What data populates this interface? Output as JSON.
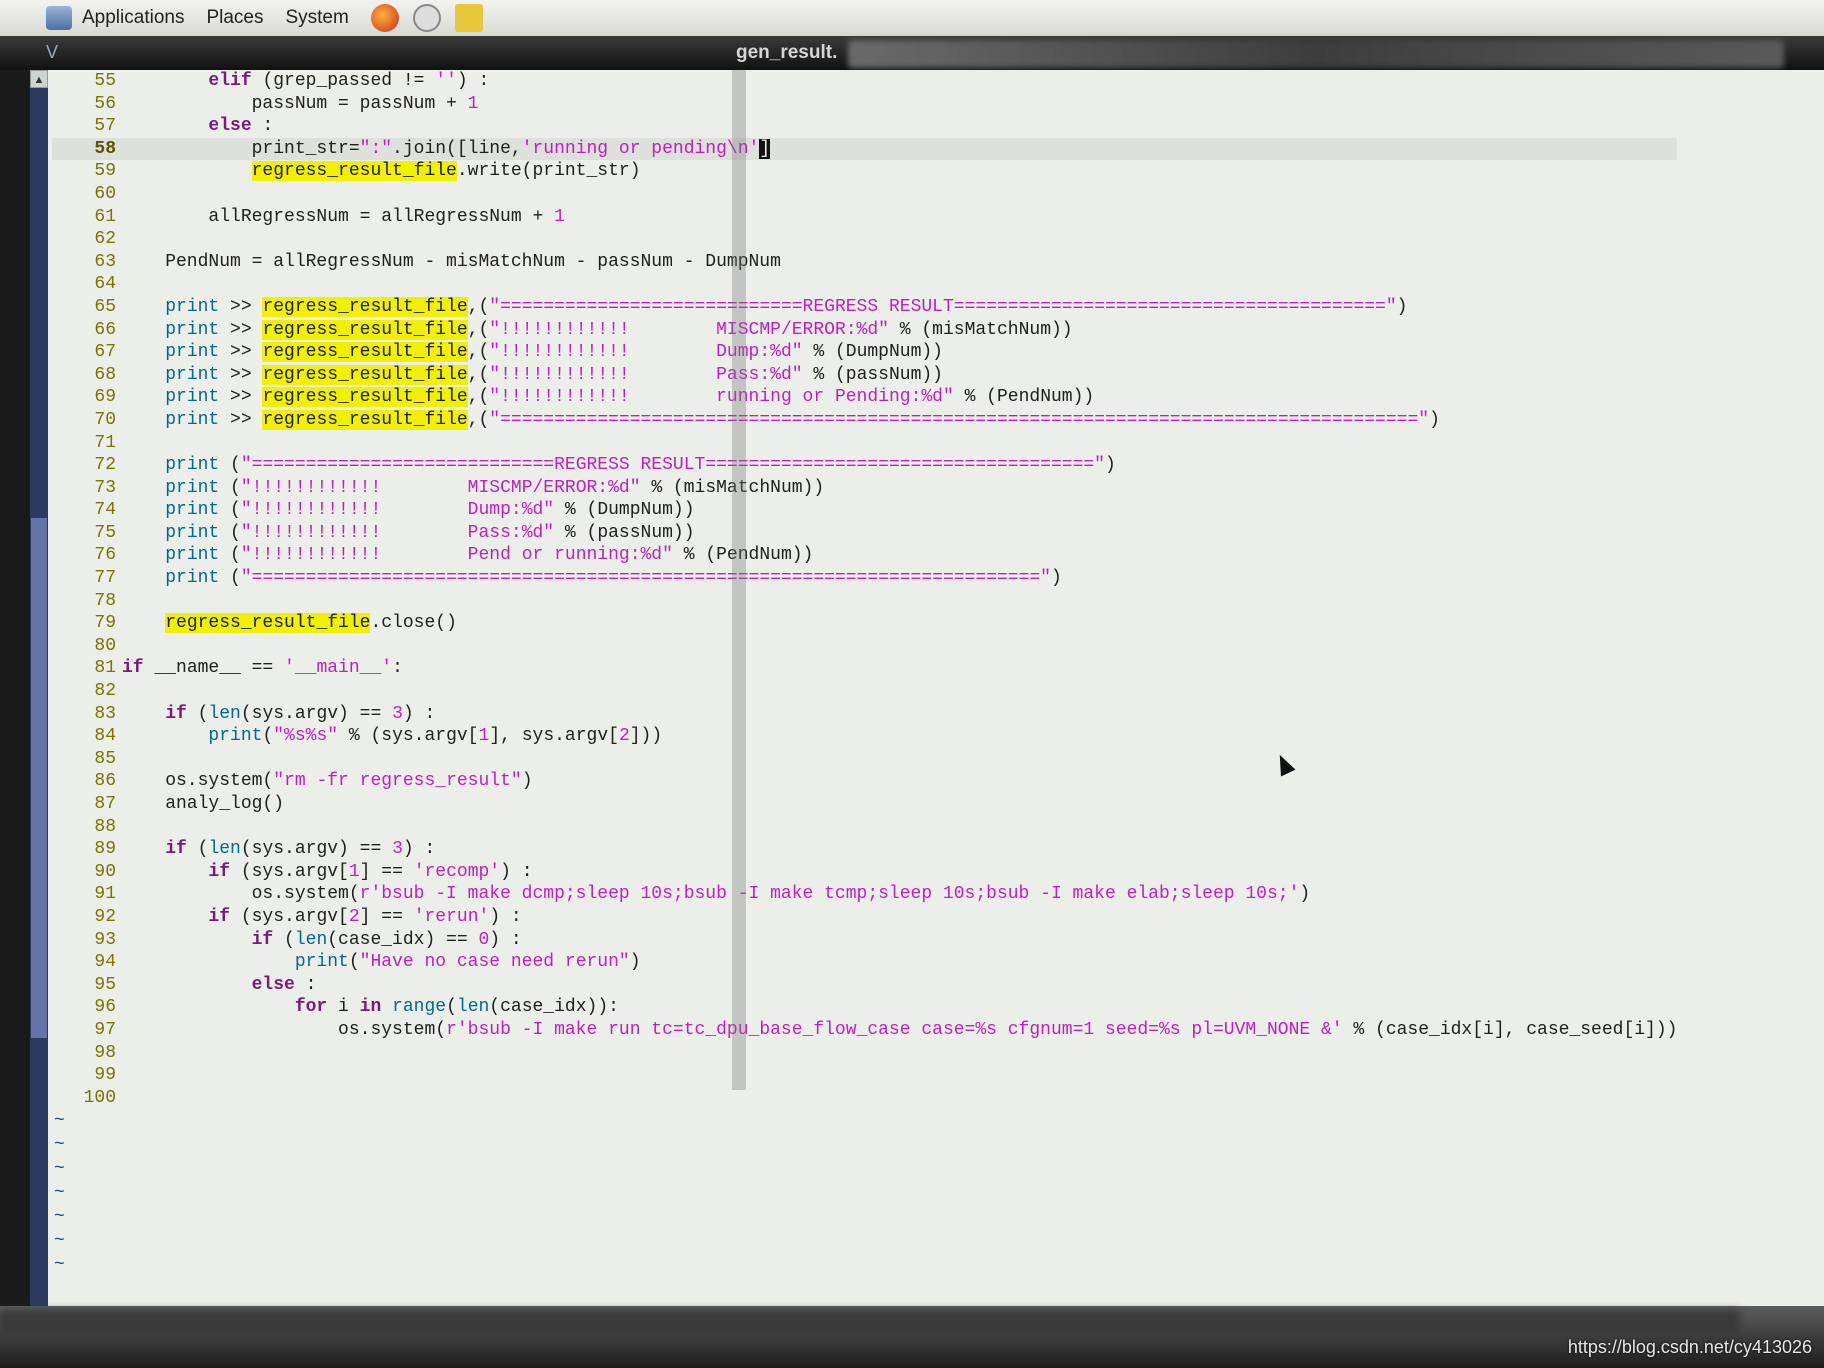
{
  "panel": {
    "applications": "Applications",
    "places": "Places",
    "system": "System"
  },
  "window": {
    "title": "gen_result."
  },
  "code": {
    "l55": "55",
    "l56": "56",
    "l57": "57",
    "l58": "58",
    "l59": "59",
    "l60": "60",
    "l61": "61",
    "l62": "62",
    "l63": "63",
    "l64": "64",
    "l65": "65",
    "l66": "66",
    "l67": "67",
    "l68": "68",
    "l69": "69",
    "l70": "70",
    "l71": "71",
    "l72": "72",
    "l73": "73",
    "l74": "74",
    "l75": "75",
    "l76": "76",
    "l77": "77",
    "l78": "78",
    "l79": "79",
    "l80": "80",
    "l81": "81",
    "l82": "82",
    "l83": "83",
    "l84": "84",
    "l85": "85",
    "l86": "86",
    "l87": "87",
    "l88": "88",
    "l89": "89",
    "l90": "90",
    "l91": "91",
    "l92": "92",
    "l93": "93",
    "l94": "94",
    "l95": "95",
    "l96": "96",
    "l97": "97",
    "l98": "98",
    "l99": "99",
    "l100": "100",
    "rrf": "regress_result_file",
    "banner_long": "\"============================REGRESS RESULT========================================\"",
    "banner_eq_long": "\"=====================================================================================\"",
    "m66": "\"!!!!!!!!!!!!        MISCMP/ERROR:%d\"",
    "m67": "\"!!!!!!!!!!!!        Dump:%d\"",
    "m68": "\"!!!!!!!!!!!!        Pass:%d\"",
    "m69": "\"!!!!!!!!!!!!        running or Pending:%d\"",
    "banner_short": "\"============================REGRESS RESULT====================================\"",
    "m73": "\"!!!!!!!!!!!!        MISCMP/ERROR:%d\"",
    "m74": "\"!!!!!!!!!!!!        Dump:%d\"",
    "m75": "\"!!!!!!!!!!!!        Pass:%d\"",
    "m76": "\"!!!!!!!!!!!!        Pend or running:%d\"",
    "banner_eq_short": "\"=========================================================================\"",
    "sys91": "r'bsub -I make dcmp;sleep 10s;bsub -I make tcmp;sleep 10s;bsub -I make elab;sleep 10s;'",
    "sys97": "r'bsub -I make run tc=tc_dpu_base_flow_case case=%s cfgnum=1 seed=%s pl=UVM_NONE &'"
  },
  "watermark": "https://blog.csdn.net/cy413026"
}
